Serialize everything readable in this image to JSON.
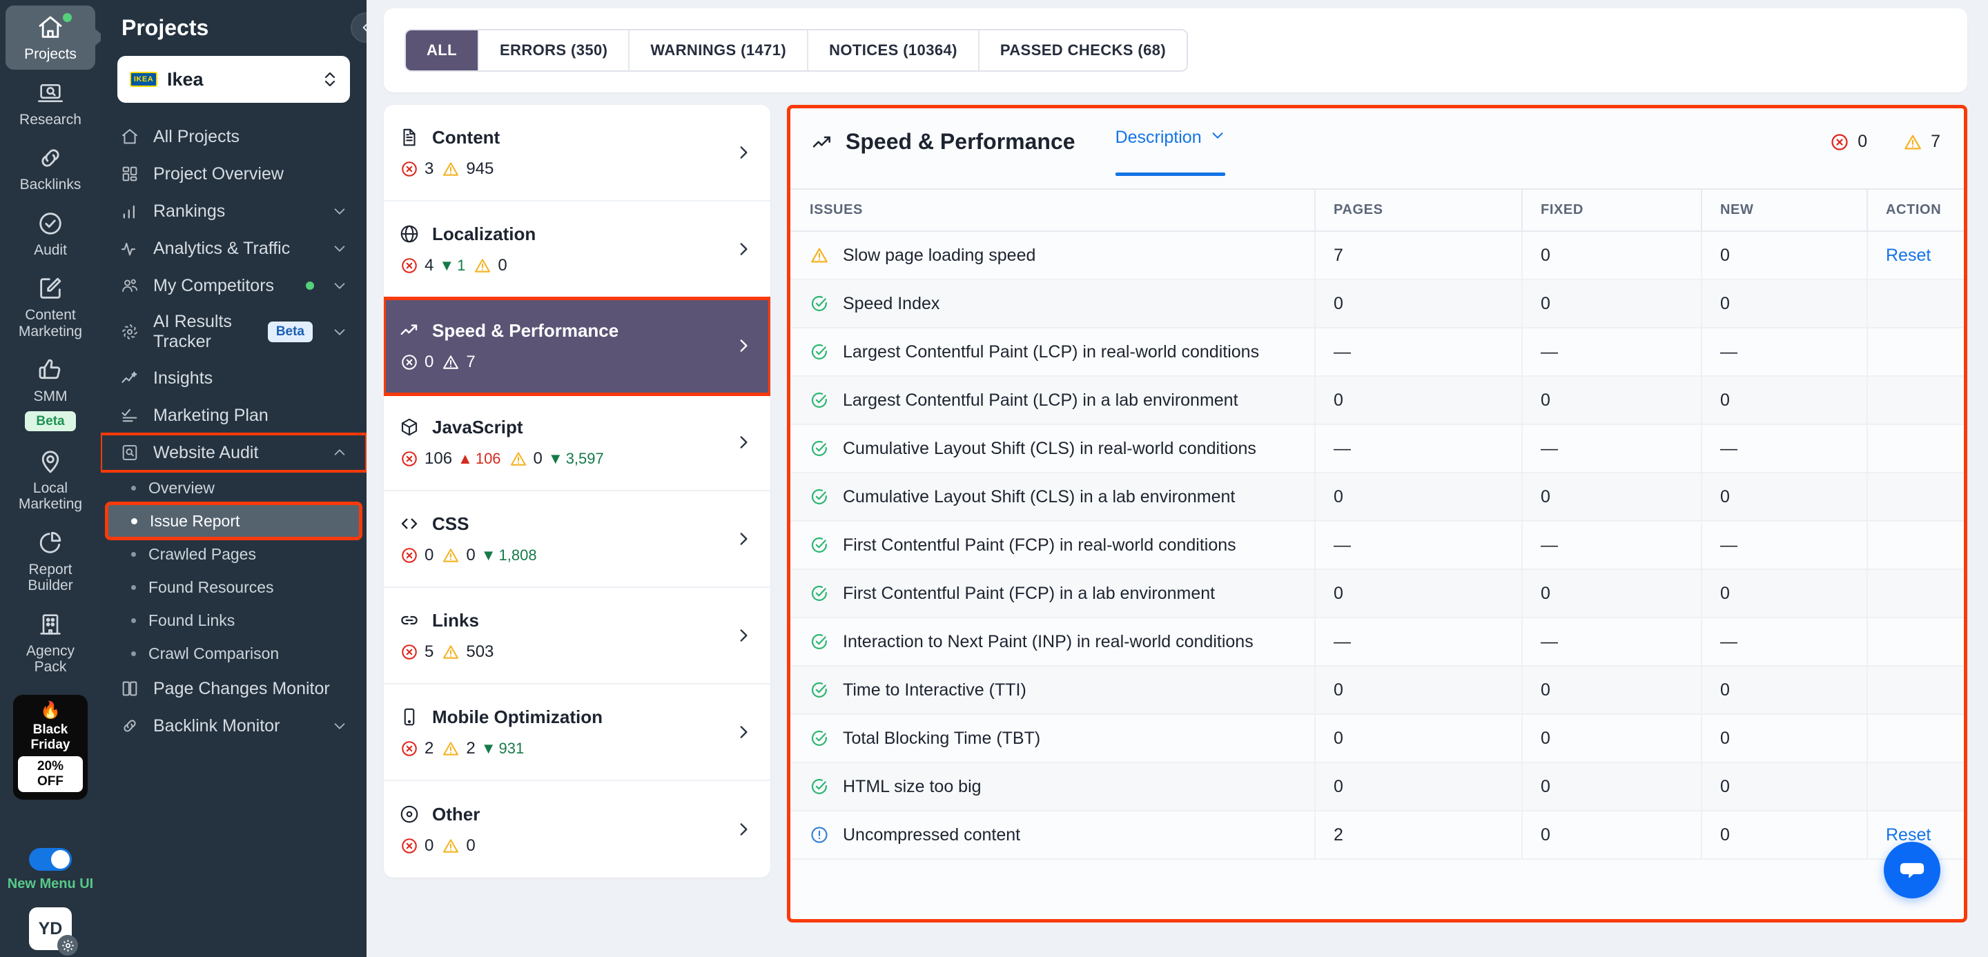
{
  "rail": {
    "items": [
      {
        "label": "Projects",
        "icon": "home-icon",
        "active": true,
        "dot": true
      },
      {
        "label": "Research",
        "icon": "laptop-search-icon",
        "active": false,
        "dot": false
      },
      {
        "label": "Backlinks",
        "icon": "link-icon",
        "active": false,
        "dot": false
      },
      {
        "label": "Audit",
        "icon": "check-circle-icon",
        "active": false,
        "dot": false
      },
      {
        "label": "Content\nMarketing",
        "icon": "edit-square-icon",
        "active": false,
        "dot": false
      },
      {
        "label": "SMM",
        "icon": "thumbs-up-icon",
        "active": false,
        "dot": false,
        "badge": "Beta"
      },
      {
        "label": "Local\nMarketing",
        "icon": "map-pin-icon",
        "active": false,
        "dot": false
      },
      {
        "label": "Report\nBuilder",
        "icon": "pie-chart-icon",
        "active": false,
        "dot": false
      },
      {
        "label": "Agency\nPack",
        "icon": "building-icon",
        "active": false,
        "dot": false
      }
    ],
    "promo": {
      "flame": "🔥",
      "title": "Black Friday",
      "offer": "20% OFF"
    },
    "toggle_label": "New Menu UI",
    "avatar_initials": "YD"
  },
  "sidebar": {
    "title": "Projects",
    "project": {
      "name": "Ikea",
      "logo_text": "IKEA"
    },
    "items": [
      {
        "label": "All Projects",
        "icon": "home-outline-icon",
        "chevron": false
      },
      {
        "label": "Project Overview",
        "icon": "dashboard-icon",
        "chevron": false
      },
      {
        "label": "Rankings",
        "icon": "bar-chart-icon",
        "chevron": "down"
      },
      {
        "label": "Analytics & Traffic",
        "icon": "pulse-icon",
        "chevron": "down"
      },
      {
        "label": "My Competitors",
        "icon": "users-icon",
        "chevron": "down",
        "dot": true
      },
      {
        "label": "AI Results Tracker",
        "icon": "ai-node-icon",
        "chevron": "down",
        "badge": "Beta"
      },
      {
        "label": "Insights",
        "icon": "insights-icon",
        "chevron": false
      },
      {
        "label": "Marketing Plan",
        "icon": "checklist-icon",
        "chevron": false
      },
      {
        "label": "Website Audit",
        "icon": "audit-search-icon",
        "chevron": "up",
        "highlighted": true
      }
    ],
    "audit_subitems": [
      {
        "label": "Overview",
        "active": false,
        "highlighted": false
      },
      {
        "label": "Issue Report",
        "active": true,
        "highlighted": true
      },
      {
        "label": "Crawled Pages",
        "active": false,
        "highlighted": false
      },
      {
        "label": "Found Resources",
        "active": false,
        "highlighted": false
      },
      {
        "label": "Found Links",
        "active": false,
        "highlighted": false
      },
      {
        "label": "Crawl Comparison",
        "active": false,
        "highlighted": false
      }
    ],
    "footer_items": [
      {
        "label": "Page Changes Monitor",
        "icon": "book-icon",
        "chevron": false
      },
      {
        "label": "Backlink Monitor",
        "icon": "link-icon",
        "chevron": "down"
      }
    ]
  },
  "tabs": [
    {
      "label": "ALL",
      "active": true
    },
    {
      "label": "ERRORS (350)",
      "active": false
    },
    {
      "label": "WARNINGS (1471)",
      "active": false
    },
    {
      "label": "NOTICES (10364)",
      "active": false
    },
    {
      "label": "PASSED CHECKS (68)",
      "active": false
    }
  ],
  "categories": [
    {
      "name": "Content",
      "icon": "document-icon",
      "errors": "3",
      "warnings": "945",
      "err_delta": null,
      "warn_delta": null,
      "selected": false
    },
    {
      "name": "Localization",
      "icon": "globe-icon",
      "errors": "4",
      "warnings": "0",
      "err_delta": {
        "dir": "down",
        "value": "1"
      },
      "warn_delta": null,
      "selected": false
    },
    {
      "name": "Speed & Performance",
      "icon": "trend-up-icon",
      "errors": "0",
      "warnings": "7",
      "err_delta": null,
      "warn_delta": null,
      "selected": true
    },
    {
      "name": "JavaScript",
      "icon": "cube-icon",
      "errors": "106",
      "warnings": "0",
      "err_delta": {
        "dir": "up",
        "value": "106"
      },
      "warn_delta": {
        "dir": "down",
        "value": "3,597"
      },
      "selected": false
    },
    {
      "name": "CSS",
      "icon": "code-icon",
      "errors": "0",
      "warnings": "0",
      "err_delta": null,
      "warn_delta": {
        "dir": "down",
        "value": "1,808"
      },
      "selected": false
    },
    {
      "name": "Links",
      "icon": "chain-icon",
      "errors": "5",
      "warnings": "503",
      "err_delta": null,
      "warn_delta": null,
      "selected": false
    },
    {
      "name": "Mobile Optimization",
      "icon": "mobile-icon",
      "errors": "2",
      "warnings": "2",
      "err_delta": null,
      "warn_delta": {
        "dir": "down",
        "value": "931"
      },
      "selected": false
    },
    {
      "name": "Other",
      "icon": "target-icon",
      "errors": "0",
      "warnings": "0",
      "err_delta": null,
      "warn_delta": null,
      "selected": false
    }
  ],
  "detail": {
    "title": "Speed & Performance",
    "description_label": "Description",
    "error_count": "0",
    "warning_count": "7",
    "columns": {
      "issues": "ISSUES",
      "pages": "PAGES",
      "fixed": "FIXED",
      "new": "NEW",
      "action": "ACTION"
    },
    "rows": [
      {
        "status": "warning",
        "issue": "Slow page loading speed",
        "pages": "7",
        "fixed": "0",
        "new": "0",
        "action": "Reset"
      },
      {
        "status": "passed",
        "issue": "Speed Index",
        "pages": "0",
        "fixed": "0",
        "new": "0",
        "action": ""
      },
      {
        "status": "passed",
        "issue": "Largest Contentful Paint (LCP) in real-world conditions",
        "pages": "—",
        "fixed": "—",
        "new": "—",
        "action": ""
      },
      {
        "status": "passed",
        "issue": "Largest Contentful Paint (LCP) in a lab environment",
        "pages": "0",
        "fixed": "0",
        "new": "0",
        "action": ""
      },
      {
        "status": "passed",
        "issue": "Cumulative Layout Shift (CLS) in real-world conditions",
        "pages": "—",
        "fixed": "—",
        "new": "—",
        "action": ""
      },
      {
        "status": "passed",
        "issue": "Cumulative Layout Shift (CLS) in a lab environment",
        "pages": "0",
        "fixed": "0",
        "new": "0",
        "action": ""
      },
      {
        "status": "passed",
        "issue": "First Contentful Paint (FCP) in real-world conditions",
        "pages": "—",
        "fixed": "—",
        "new": "—",
        "action": ""
      },
      {
        "status": "passed",
        "issue": "First Contentful Paint (FCP) in a lab environment",
        "pages": "0",
        "fixed": "0",
        "new": "0",
        "action": ""
      },
      {
        "status": "passed",
        "issue": "Interaction to Next Paint (INP) in real-world conditions",
        "pages": "—",
        "fixed": "—",
        "new": "—",
        "action": ""
      },
      {
        "status": "passed",
        "issue": "Time to Interactive (TTI)",
        "pages": "0",
        "fixed": "0",
        "new": "0",
        "action": ""
      },
      {
        "status": "passed",
        "issue": "Total Blocking Time (TBT)",
        "pages": "0",
        "fixed": "0",
        "new": "0",
        "action": ""
      },
      {
        "status": "passed",
        "issue": "HTML size too big",
        "pages": "0",
        "fixed": "0",
        "new": "0",
        "action": ""
      },
      {
        "status": "notice",
        "issue": "Uncompressed content",
        "pages": "2",
        "fixed": "0",
        "new": "0",
        "action": "Reset"
      }
    ]
  },
  "colors": {
    "rail_bg": "#263340",
    "sidebar_bg": "#253340",
    "accent_selected": "#5b5475",
    "highlight_outline": "#f93a0a",
    "link_blue": "#1473e6",
    "error_red": "#e0261d",
    "warning_yellow": "#f5b323",
    "passed_green": "#2fb673",
    "notice_blue": "#3b82d6",
    "green_accent": "#54d17a"
  }
}
